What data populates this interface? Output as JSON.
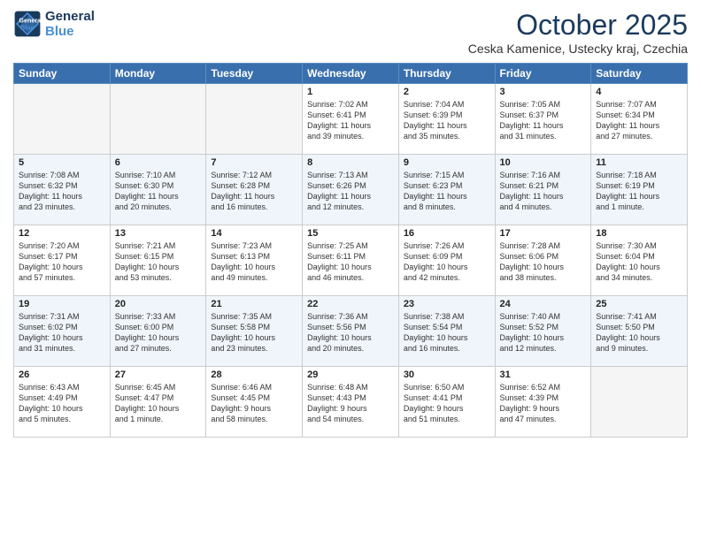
{
  "header": {
    "logo_line1": "General",
    "logo_line2": "Blue",
    "month_title": "October 2025",
    "location": "Ceska Kamenice, Ustecky kraj, Czechia"
  },
  "weekdays": [
    "Sunday",
    "Monday",
    "Tuesday",
    "Wednesday",
    "Thursday",
    "Friday",
    "Saturday"
  ],
  "weeks": [
    [
      {
        "day": "",
        "content": ""
      },
      {
        "day": "",
        "content": ""
      },
      {
        "day": "",
        "content": ""
      },
      {
        "day": "1",
        "content": "Sunrise: 7:02 AM\nSunset: 6:41 PM\nDaylight: 11 hours\nand 39 minutes."
      },
      {
        "day": "2",
        "content": "Sunrise: 7:04 AM\nSunset: 6:39 PM\nDaylight: 11 hours\nand 35 minutes."
      },
      {
        "day": "3",
        "content": "Sunrise: 7:05 AM\nSunset: 6:37 PM\nDaylight: 11 hours\nand 31 minutes."
      },
      {
        "day": "4",
        "content": "Sunrise: 7:07 AM\nSunset: 6:34 PM\nDaylight: 11 hours\nand 27 minutes."
      }
    ],
    [
      {
        "day": "5",
        "content": "Sunrise: 7:08 AM\nSunset: 6:32 PM\nDaylight: 11 hours\nand 23 minutes."
      },
      {
        "day": "6",
        "content": "Sunrise: 7:10 AM\nSunset: 6:30 PM\nDaylight: 11 hours\nand 20 minutes."
      },
      {
        "day": "7",
        "content": "Sunrise: 7:12 AM\nSunset: 6:28 PM\nDaylight: 11 hours\nand 16 minutes."
      },
      {
        "day": "8",
        "content": "Sunrise: 7:13 AM\nSunset: 6:26 PM\nDaylight: 11 hours\nand 12 minutes."
      },
      {
        "day": "9",
        "content": "Sunrise: 7:15 AM\nSunset: 6:23 PM\nDaylight: 11 hours\nand 8 minutes."
      },
      {
        "day": "10",
        "content": "Sunrise: 7:16 AM\nSunset: 6:21 PM\nDaylight: 11 hours\nand 4 minutes."
      },
      {
        "day": "11",
        "content": "Sunrise: 7:18 AM\nSunset: 6:19 PM\nDaylight: 11 hours\nand 1 minute."
      }
    ],
    [
      {
        "day": "12",
        "content": "Sunrise: 7:20 AM\nSunset: 6:17 PM\nDaylight: 10 hours\nand 57 minutes."
      },
      {
        "day": "13",
        "content": "Sunrise: 7:21 AM\nSunset: 6:15 PM\nDaylight: 10 hours\nand 53 minutes."
      },
      {
        "day": "14",
        "content": "Sunrise: 7:23 AM\nSunset: 6:13 PM\nDaylight: 10 hours\nand 49 minutes."
      },
      {
        "day": "15",
        "content": "Sunrise: 7:25 AM\nSunset: 6:11 PM\nDaylight: 10 hours\nand 46 minutes."
      },
      {
        "day": "16",
        "content": "Sunrise: 7:26 AM\nSunset: 6:09 PM\nDaylight: 10 hours\nand 42 minutes."
      },
      {
        "day": "17",
        "content": "Sunrise: 7:28 AM\nSunset: 6:06 PM\nDaylight: 10 hours\nand 38 minutes."
      },
      {
        "day": "18",
        "content": "Sunrise: 7:30 AM\nSunset: 6:04 PM\nDaylight: 10 hours\nand 34 minutes."
      }
    ],
    [
      {
        "day": "19",
        "content": "Sunrise: 7:31 AM\nSunset: 6:02 PM\nDaylight: 10 hours\nand 31 minutes."
      },
      {
        "day": "20",
        "content": "Sunrise: 7:33 AM\nSunset: 6:00 PM\nDaylight: 10 hours\nand 27 minutes."
      },
      {
        "day": "21",
        "content": "Sunrise: 7:35 AM\nSunset: 5:58 PM\nDaylight: 10 hours\nand 23 minutes."
      },
      {
        "day": "22",
        "content": "Sunrise: 7:36 AM\nSunset: 5:56 PM\nDaylight: 10 hours\nand 20 minutes."
      },
      {
        "day": "23",
        "content": "Sunrise: 7:38 AM\nSunset: 5:54 PM\nDaylight: 10 hours\nand 16 minutes."
      },
      {
        "day": "24",
        "content": "Sunrise: 7:40 AM\nSunset: 5:52 PM\nDaylight: 10 hours\nand 12 minutes."
      },
      {
        "day": "25",
        "content": "Sunrise: 7:41 AM\nSunset: 5:50 PM\nDaylight: 10 hours\nand 9 minutes."
      }
    ],
    [
      {
        "day": "26",
        "content": "Sunrise: 6:43 AM\nSunset: 4:49 PM\nDaylight: 10 hours\nand 5 minutes."
      },
      {
        "day": "27",
        "content": "Sunrise: 6:45 AM\nSunset: 4:47 PM\nDaylight: 10 hours\nand 1 minute."
      },
      {
        "day": "28",
        "content": "Sunrise: 6:46 AM\nSunset: 4:45 PM\nDaylight: 9 hours\nand 58 minutes."
      },
      {
        "day": "29",
        "content": "Sunrise: 6:48 AM\nSunset: 4:43 PM\nDaylight: 9 hours\nand 54 minutes."
      },
      {
        "day": "30",
        "content": "Sunrise: 6:50 AM\nSunset: 4:41 PM\nDaylight: 9 hours\nand 51 minutes."
      },
      {
        "day": "31",
        "content": "Sunrise: 6:52 AM\nSunset: 4:39 PM\nDaylight: 9 hours\nand 47 minutes."
      },
      {
        "day": "",
        "content": ""
      }
    ]
  ]
}
